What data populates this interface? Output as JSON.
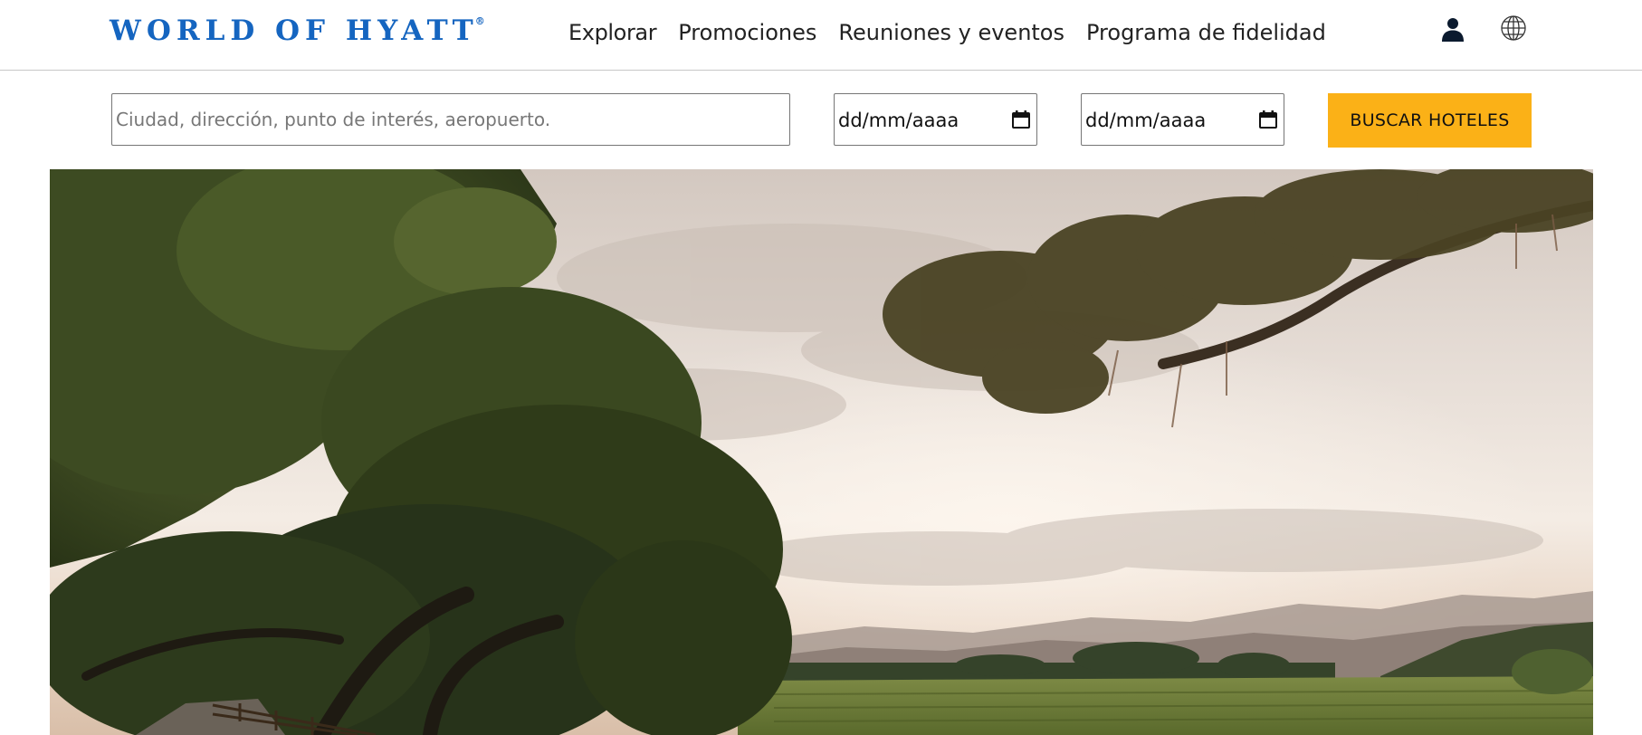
{
  "brand": {
    "logo_text": "WORLD OF HYATT",
    "reg_mark": "®",
    "color": "#1565c0"
  },
  "nav": {
    "items": [
      "Explorar",
      "Promociones",
      "Reuniones y eventos",
      "Programa de fidelidad"
    ]
  },
  "header_icons": [
    "user-icon",
    "globe-icon"
  ],
  "search": {
    "destination_placeholder": "Ciudad, dirección, punto de interés, aeropuerto.",
    "checkin_value": "dd/mm/aaaa",
    "checkout_value": "dd/mm/aaaa",
    "submit_label": "BUSCAR HOTELES",
    "accent_color": "#fbb117"
  },
  "hero": {
    "image": "vineyard-landscape-with-oak-trees-at-sunset"
  }
}
